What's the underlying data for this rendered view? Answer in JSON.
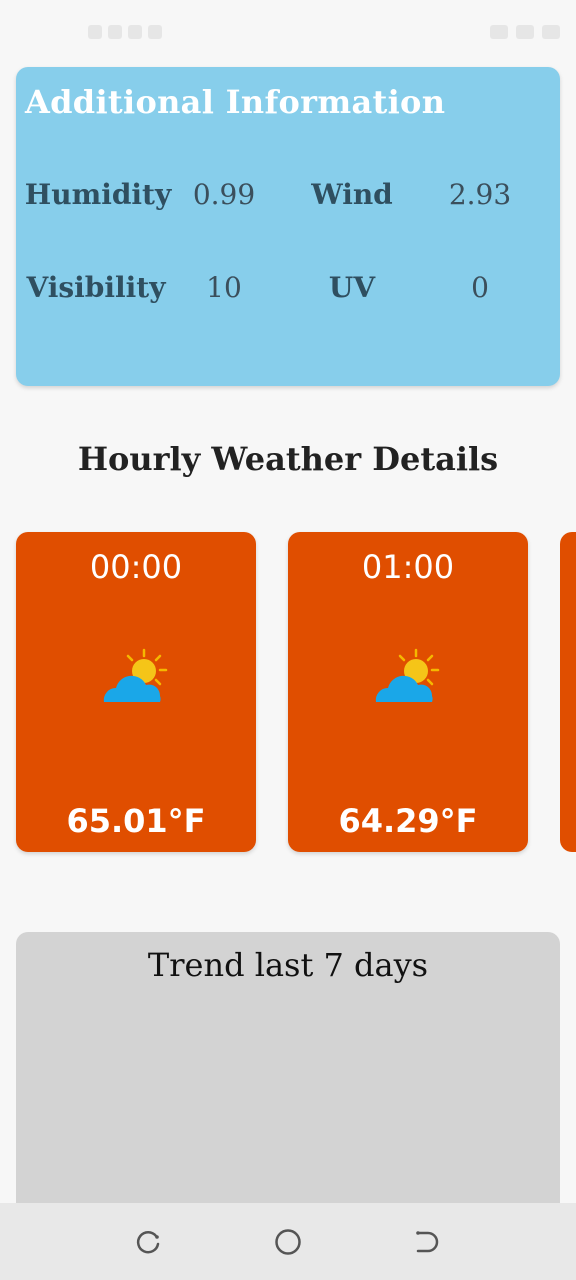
{
  "additional_info": {
    "title": "Additional Information",
    "humidity_label": "Humidity",
    "humidity_value": "0.99",
    "wind_label": "Wind",
    "wind_value": "2.93",
    "visibility_label": "Visibility",
    "visibility_value": "10",
    "uv_label": "UV",
    "uv_value": "0"
  },
  "hourly": {
    "heading": "Hourly Weather Details",
    "items": [
      {
        "time": "00:00",
        "icon": "partly-cloudy-icon",
        "temp": "65.01°F"
      },
      {
        "time": "01:00",
        "icon": "partly-cloudy-icon",
        "temp": "64.29°F"
      }
    ]
  },
  "trend": {
    "title": "Trend last 7 days"
  },
  "colors": {
    "info_card": "#87ceeb",
    "hour_card": "#e04e00",
    "trend_card": "#d3d3d3"
  }
}
